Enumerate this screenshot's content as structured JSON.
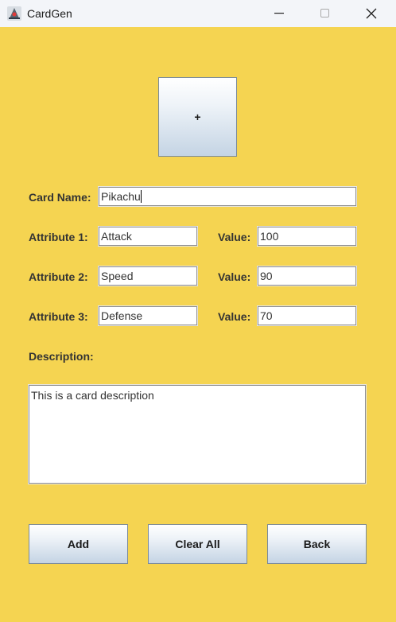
{
  "window": {
    "title": "CardGen"
  },
  "image_button": {
    "label": "+"
  },
  "form": {
    "card_name_label": "Card Name:",
    "card_name_value": "Pikachu",
    "attributes": [
      {
        "label": "Attribute 1:",
        "value": "Attack",
        "value_label": "Value:",
        "number": "100"
      },
      {
        "label": "Attribute 2:",
        "value": "Speed",
        "value_label": "Value:",
        "number": "90"
      },
      {
        "label": "Attribute 3:",
        "value": "Defense",
        "value_label": "Value:",
        "number": "70"
      }
    ],
    "description_label": "Description:",
    "description_value": "This is a card description"
  },
  "buttons": {
    "add": "Add",
    "clear_all": "Clear All",
    "back": "Back"
  },
  "icons": {
    "app": "cardgen-app-icon",
    "minimize": "minimize-icon",
    "maximize": "maximize-icon",
    "close": "close-icon"
  },
  "colors": {
    "background": "#f5d451",
    "titlebar": "#f3f5f9"
  }
}
